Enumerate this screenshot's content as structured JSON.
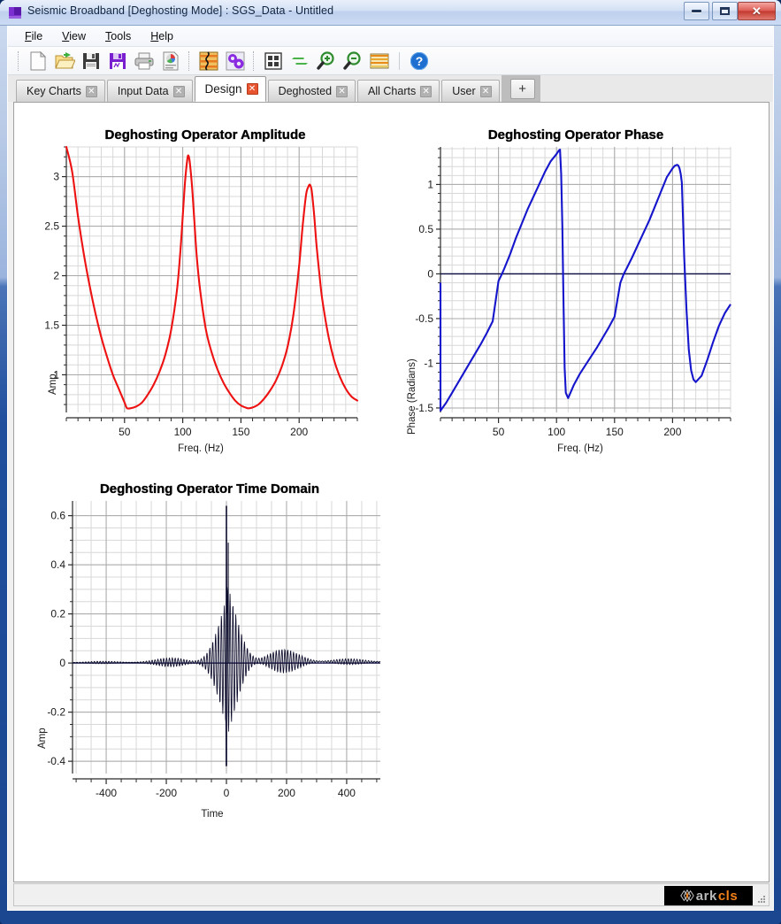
{
  "window": {
    "title": "Seismic Broadband [Deghosting Mode] : SGS_Data - Untitled",
    "icon": "app-window-icon",
    "minimize_label": "",
    "maximize_label": "",
    "close_label": "✕"
  },
  "menu": {
    "items": [
      {
        "label": "File",
        "accel": "F"
      },
      {
        "label": "View",
        "accel": "V"
      },
      {
        "label": "Tools",
        "accel": "T"
      },
      {
        "label": "Help",
        "accel": "H"
      }
    ]
  },
  "toolbar": {
    "buttons": [
      {
        "name": "new-file-icon",
        "tip": "New"
      },
      {
        "name": "open-folder-icon",
        "tip": "Open"
      },
      {
        "name": "save-icon",
        "tip": "Save"
      },
      {
        "name": "save-as-icon",
        "tip": "Save As"
      },
      {
        "name": "print-icon",
        "tip": "Print"
      },
      {
        "name": "report-icon",
        "tip": "Report"
      },
      {
        "name": "seismic-trace-icon",
        "tip": "Seismic Display"
      },
      {
        "name": "process-gears-icon",
        "tip": "Process"
      },
      {
        "name": "tile-windows-icon",
        "tip": "Tile"
      },
      {
        "name": "refresh-icon",
        "tip": "Refresh"
      },
      {
        "name": "zoom-in-icon",
        "tip": "Zoom In"
      },
      {
        "name": "zoom-out-icon",
        "tip": "Zoom Out"
      },
      {
        "name": "spectrum-icon",
        "tip": "Spectrum"
      },
      {
        "name": "help-icon",
        "tip": "Help"
      }
    ]
  },
  "tabs": {
    "items": [
      {
        "label": "Key Charts",
        "active": false,
        "closable": true
      },
      {
        "label": "Input Data",
        "active": false,
        "closable": true
      },
      {
        "label": "Design",
        "active": true,
        "closable": true
      },
      {
        "label": "Deghosted",
        "active": false,
        "closable": true
      },
      {
        "label": "All Charts",
        "active": false,
        "closable": true
      },
      {
        "label": "User",
        "active": false,
        "closable": true
      }
    ],
    "close_glyph": "✕",
    "add_label": "+"
  },
  "statusbar": {
    "message": "",
    "logo_text_1": "ark",
    "logo_text_2": "cls",
    "logo_accent": "#f08018"
  },
  "chart_data": [
    {
      "id": "amplitude",
      "type": "line",
      "title": "Deghosting Operator Amplitude",
      "xlabel": "Freq. (Hz)",
      "ylabel": "Amp.",
      "color": "#ee1111",
      "xlim": [
        0,
        250
      ],
      "ylim": [
        0.62,
        3.3
      ],
      "xticks": [
        50,
        100,
        150,
        200
      ],
      "yticks": [
        1,
        1.5,
        2,
        2.5,
        3
      ],
      "grid": true,
      "legend": "none",
      "x": [
        0,
        5,
        10,
        15,
        20,
        25,
        30,
        35,
        40,
        45,
        50,
        52,
        55,
        60,
        65,
        70,
        75,
        80,
        85,
        90,
        95,
        98,
        100,
        102,
        104,
        105,
        106,
        108,
        110,
        112,
        115,
        120,
        125,
        130,
        135,
        140,
        145,
        150,
        155,
        157,
        160,
        165,
        170,
        175,
        180,
        185,
        190,
        195,
        200,
        203,
        206,
        208,
        209,
        210,
        211,
        213,
        215,
        218,
        220,
        225,
        230,
        235,
        240,
        245,
        250
      ],
      "y": [
        3.4,
        3.05,
        2.6,
        2.22,
        1.9,
        1.62,
        1.38,
        1.18,
        1.0,
        0.86,
        0.72,
        0.665,
        0.662,
        0.68,
        0.72,
        0.8,
        0.9,
        1.03,
        1.2,
        1.45,
        1.85,
        2.25,
        2.6,
        2.95,
        3.18,
        3.21,
        3.15,
        2.9,
        2.55,
        2.2,
        1.85,
        1.45,
        1.22,
        1.05,
        0.92,
        0.82,
        0.74,
        0.69,
        0.665,
        0.662,
        0.67,
        0.7,
        0.76,
        0.84,
        0.94,
        1.08,
        1.28,
        1.6,
        2.1,
        2.5,
        2.82,
        2.9,
        2.92,
        2.9,
        2.84,
        2.6,
        2.3,
        1.95,
        1.75,
        1.4,
        1.15,
        0.98,
        0.86,
        0.78,
        0.74
      ]
    },
    {
      "id": "phase",
      "type": "line",
      "title": "Deghosting Operator Phase",
      "xlabel": "Freq. (Hz)",
      "ylabel": "Phase (Radians)",
      "color": "#1515cc",
      "xlim": [
        0,
        250
      ],
      "ylim": [
        -1.55,
        1.42
      ],
      "xticks": [
        50,
        100,
        150,
        200
      ],
      "yticks": [
        -1.5,
        -1,
        -0.5,
        0,
        0.5,
        1
      ],
      "grid": true,
      "legend": "none",
      "zero_line": 0,
      "x": [
        0,
        0,
        5,
        10,
        15,
        20,
        25,
        30,
        35,
        40,
        45,
        50,
        53,
        55,
        60,
        65,
        70,
        75,
        80,
        85,
        90,
        95,
        100,
        102,
        103,
        104,
        105,
        106,
        107,
        108,
        110,
        112,
        115,
        120,
        125,
        130,
        135,
        140,
        145,
        150,
        155,
        158,
        160,
        165,
        170,
        175,
        180,
        185,
        190,
        195,
        200,
        202,
        204,
        205,
        206,
        207,
        208,
        209,
        210,
        212,
        214,
        216,
        218,
        220,
        225,
        230,
        235,
        240,
        245,
        250
      ],
      "y": [
        -0.1,
        -1.53,
        -1.44,
        -1.33,
        -1.22,
        -1.11,
        -1.0,
        -0.89,
        -0.78,
        -0.66,
        -0.53,
        -0.08,
        0.0,
        0.06,
        0.22,
        0.4,
        0.56,
        0.72,
        0.86,
        1.0,
        1.14,
        1.26,
        1.34,
        1.38,
        1.39,
        1.12,
        0.55,
        -0.3,
        -1.05,
        -1.33,
        -1.39,
        -1.33,
        -1.24,
        -1.12,
        -1.02,
        -0.92,
        -0.82,
        -0.71,
        -0.6,
        -0.48,
        -0.1,
        0.0,
        0.05,
        0.18,
        0.32,
        0.46,
        0.6,
        0.76,
        0.92,
        1.08,
        1.18,
        1.21,
        1.22,
        1.21,
        1.18,
        1.12,
        1.02,
        0.62,
        0.2,
        -0.4,
        -0.85,
        -1.08,
        -1.18,
        -1.21,
        -1.14,
        -0.96,
        -0.76,
        -0.58,
        -0.44,
        -0.34
      ]
    },
    {
      "id": "time-domain",
      "type": "line",
      "title": "Deghosting Operator Time Domain",
      "xlabel": "Time",
      "ylabel": "Amp",
      "color": "#0b0b2b",
      "xlim": [
        -512,
        512
      ],
      "ylim": [
        -0.45,
        0.66
      ],
      "xticks": [
        -400,
        -200,
        0,
        200,
        400
      ],
      "yticks": [
        -0.4,
        -0.2,
        0,
        0.2,
        0.4,
        0.6
      ],
      "grid": true,
      "legend": "none",
      "description": "Oscillatory deghosting operator wavelet; large spike at t=0 reaching +0.64 and -0.42, decaying ringing envelope either side",
      "spike_peak_positive": 0.64,
      "spike_peak_negative": -0.42,
      "secondary_peak": 0.49,
      "envelope_peak_right": 0.3,
      "envelope_peak_left": -0.24
    }
  ]
}
